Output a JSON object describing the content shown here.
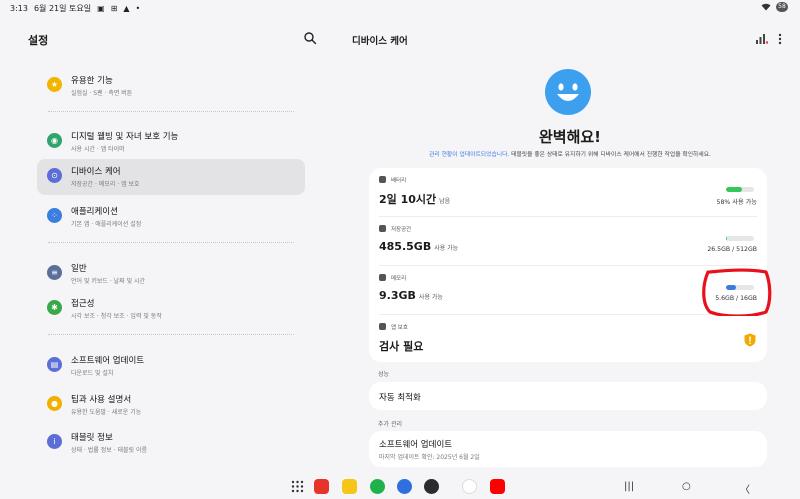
{
  "status_bar": {
    "time": "3:13",
    "date": "6월 21일 토요일",
    "battery": "58"
  },
  "settings": {
    "title": "설정",
    "items": [
      {
        "label": "유용한 기능",
        "sub": "실험실 · S펜 · 측면 버튼",
        "color": "#f3b400"
      },
      {
        "label": "디지털 웰빙 및 자녀 보호 기능",
        "sub": "사용 시간 · 앱 타이머",
        "color": "#31a46b"
      },
      {
        "label": "디바이스 케어",
        "sub": "저장공간 · 메모리 · 앱 보호",
        "color": "#5b6fd6"
      },
      {
        "label": "애플리케이션",
        "sub": "기본 앱 · 애플리케이션 설정",
        "color": "#3c7de0"
      },
      {
        "label": "일반",
        "sub": "언어 및 키보드 · 날짜 및 시간",
        "color": "#5a6f9a"
      },
      {
        "label": "접근성",
        "sub": "시각 보조 · 청각 보조 · 입력 및 동작",
        "color": "#38a84a"
      },
      {
        "label": "소프트웨어 업데이트",
        "sub": "다운로드 및 설치",
        "color": "#5b6fd6"
      },
      {
        "label": "팁과 사용 설명서",
        "sub": "유용한 도움말 · 새로운 기능",
        "color": "#f0b000"
      },
      {
        "label": "태블릿 정보",
        "sub": "상태 · 법률 정보 · 태블릿 이름",
        "color": "#5b6fd6"
      }
    ]
  },
  "device_care": {
    "title": "디바이스 케어",
    "headline": "완벽해요!",
    "status_link": "관리 현황이 업데이트되었습니다.",
    "status_text": " 태블릿을 좋은 상태로 유지하기 위해 디바이스 케어에서 진행한 작업을 확인하세요.",
    "battery": {
      "label": "배터리",
      "value": "2일 10시간",
      "unit": "남음",
      "detail": "58% 사용 가능",
      "level": 0.58,
      "color": "#35c759"
    },
    "storage": {
      "label": "저장공간",
      "value": "485.5GB",
      "unit": "사용 가능",
      "detail": "26.5GB / 512GB",
      "level": 0.05,
      "color": "#2bbcd4"
    },
    "memory": {
      "label": "메모리",
      "value": "9.3GB",
      "unit": "사용 가능",
      "detail": "5.6GB / 16GB",
      "level": 0.35,
      "color": "#3b7be0"
    },
    "app_protect": {
      "label": "앱 보호",
      "value": "검사 필요"
    },
    "performance": {
      "group": "성능",
      "item": "자동 최적화"
    },
    "additional": {
      "group": "추가 관리",
      "item": "소프트웨어 업데이트",
      "sub": "마지막 업데이트 확인: 2025년 6월 2일"
    }
  }
}
